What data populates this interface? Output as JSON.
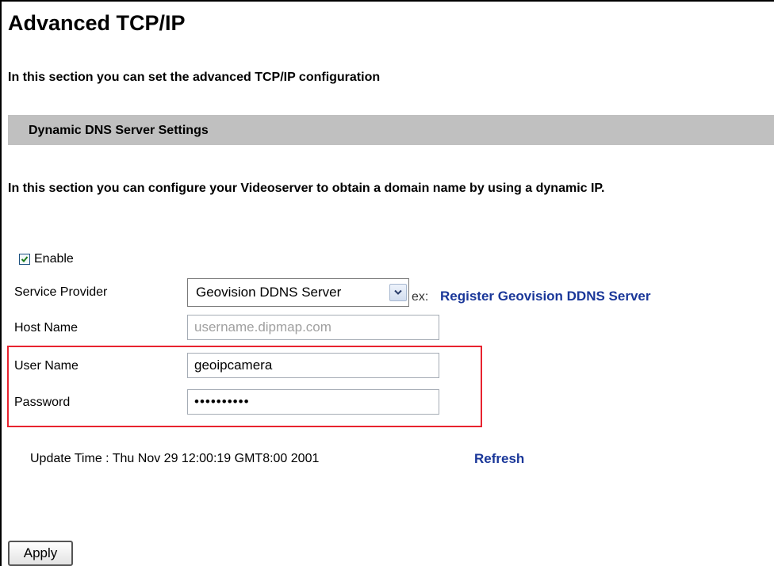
{
  "page": {
    "title": "Advanced TCP/IP",
    "intro": "In this section you can set the advanced TCP/IP configuration"
  },
  "section": {
    "header": "Dynamic DNS Server Settings",
    "description": "In this section you can configure your Videoserver to obtain a domain name by using a dynamic IP."
  },
  "form": {
    "enable": {
      "label": "Enable",
      "checked": true
    },
    "service_provider": {
      "label": "Service Provider",
      "selected": "Geovision DDNS Server",
      "ex_text": "ex:",
      "register_link": "Register Geovision DDNS Server"
    },
    "host_name": {
      "label": "Host Name",
      "value": "",
      "placeholder": "username.dipmap.com"
    },
    "user_name": {
      "label": "User Name",
      "value": "geoipcamera"
    },
    "password": {
      "label": "Password",
      "value": "••••••••••"
    }
  },
  "update": {
    "text": "Update Time : Thu Nov 29 12:00:19 GMT8:00 2001",
    "refresh_label": "Refresh"
  },
  "actions": {
    "apply_label": "Apply"
  },
  "colors": {
    "section_bar": "#c0c0c0",
    "link": "#1a3799",
    "highlight_border": "#e8232f"
  },
  "icons": {
    "enable_checkbox": "checkmark-icon",
    "dropdown_arrow": "chevron-down-icon"
  }
}
